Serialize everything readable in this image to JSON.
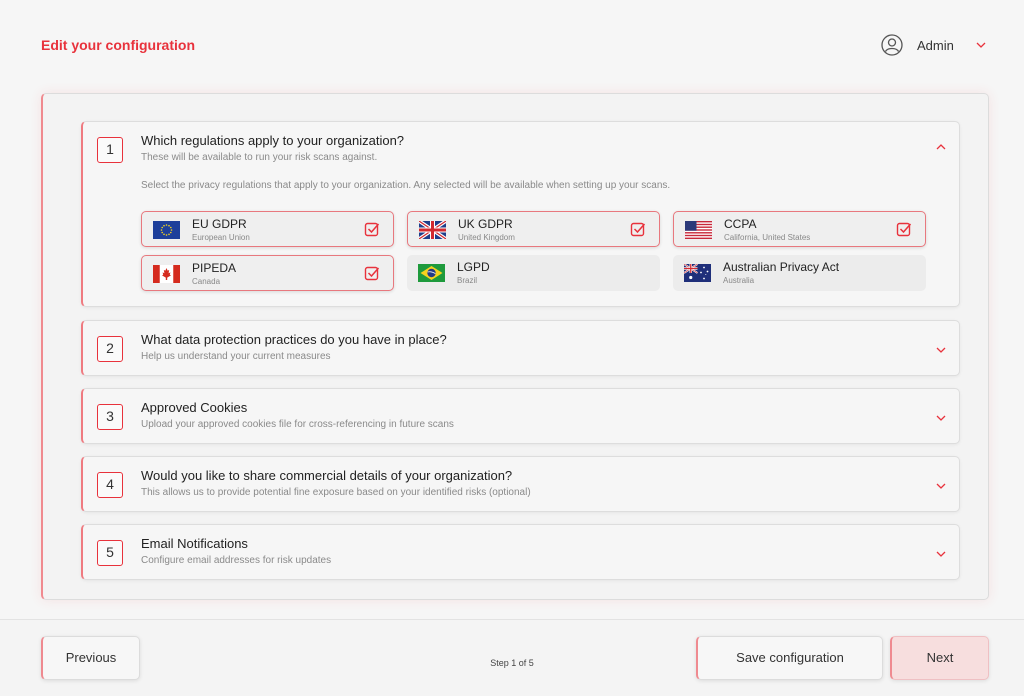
{
  "header": {
    "title": "Edit your configuration",
    "user_name": "Admin",
    "user_icon": "user-circle-icon",
    "menu_icon": "chevron-down-icon"
  },
  "colors": {
    "accent": "#e8323c",
    "accent_soft": "#f7dede",
    "background": "#f6f6f6"
  },
  "sections": [
    {
      "number": "1",
      "title": "Which regulations apply to your organization?",
      "subtitle": "These will be available to run your risk scans against.",
      "expanded": true,
      "intro": "Select the privacy regulations that apply to your organization. Any selected will be available when setting up your scans.",
      "regulations": [
        {
          "name": "EU GDPR",
          "region": "European Union",
          "flag": "eu-flag-icon",
          "selected": true
        },
        {
          "name": "UK GDPR",
          "region": "United Kingdom",
          "flag": "uk-flag-icon",
          "selected": true
        },
        {
          "name": "CCPA",
          "region": "California, United States",
          "flag": "us-flag-icon",
          "selected": true
        },
        {
          "name": "PIPEDA",
          "region": "Canada",
          "flag": "canada-flag-icon",
          "selected": true
        },
        {
          "name": "LGPD",
          "region": "Brazil",
          "flag": "brazil-flag-icon",
          "selected": false
        },
        {
          "name": "Australian Privacy Act",
          "region": "Australia",
          "flag": "australia-flag-icon",
          "selected": false
        }
      ]
    },
    {
      "number": "2",
      "title": "What data protection practices do you have in place?",
      "subtitle": "Help us understand your current measures",
      "expanded": false
    },
    {
      "number": "3",
      "title": "Approved Cookies",
      "subtitle": "Upload your approved cookies file for cross-referencing in future scans",
      "expanded": false
    },
    {
      "number": "4",
      "title": "Would you like to share commercial details of your organization?",
      "subtitle": "This allows us to provide potential fine exposure based on your identified risks (optional)",
      "expanded": false
    },
    {
      "number": "5",
      "title": "Email Notifications",
      "subtitle": "Configure email addresses for risk updates",
      "expanded": false
    }
  ],
  "footer": {
    "previous_label": "Previous",
    "step_text": "Step 1 of 5",
    "save_label": "Save configuration",
    "next_label": "Next"
  }
}
